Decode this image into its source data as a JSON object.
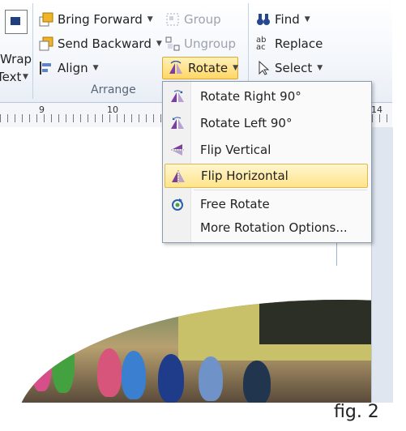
{
  "ribbon": {
    "wrap_text": {
      "line1": "Wrap",
      "line2": "Text"
    },
    "arrange": {
      "bring_forward": "Bring Forward",
      "send_backward": "Send Backward",
      "align": "Align",
      "group": "Group",
      "ungroup": "Ungroup",
      "rotate": "Rotate",
      "group_label": "Arrange"
    },
    "editing": {
      "find": "Find",
      "replace": "Replace",
      "select": "Select"
    }
  },
  "ruler": {
    "numbers": [
      "9",
      "10",
      "14"
    ]
  },
  "rotate_menu": {
    "items": [
      {
        "label": "Rotate Right 90°",
        "icon": "rotate-right-icon"
      },
      {
        "label": "Rotate Left 90°",
        "icon": "rotate-left-icon"
      },
      {
        "label": "Flip Vertical",
        "icon": "flip-vertical-icon"
      },
      {
        "label": "Flip Horizontal",
        "icon": "flip-horizontal-icon",
        "highlighted": true
      },
      {
        "label": "Free Rotate",
        "icon": "free-rotate-icon"
      },
      {
        "label": "More Rotation Options...",
        "icon": ""
      }
    ]
  },
  "caption": "fig. 2",
  "colors": {
    "highlight": "#ffe48a",
    "accent": "#7b3fa0"
  }
}
